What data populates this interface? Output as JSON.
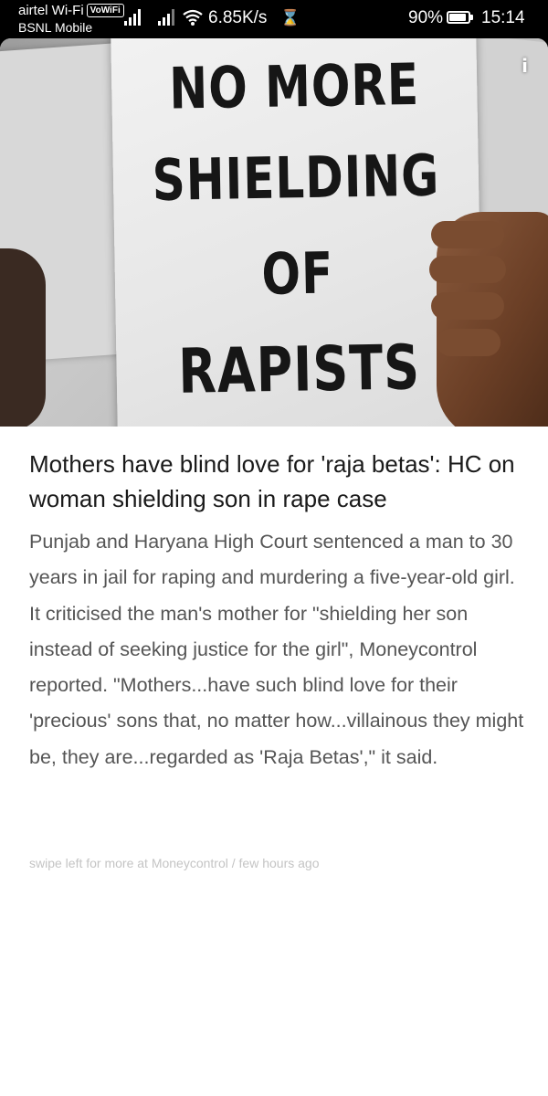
{
  "status_bar": {
    "carrier_primary": "airtel Wi-Fi",
    "volte_badge": "VoWiFi",
    "carrier_secondary": "BSNL Mobile",
    "network_speed": "6.85K/s",
    "battery_percent": "90%",
    "battery_level": 0.9,
    "time": "15:14",
    "icons": [
      "signal-icon",
      "signal-icon",
      "wifi-icon",
      "hourglass-icon",
      "battery-icon"
    ]
  },
  "article": {
    "image_sign_lines": [
      "NO MORE",
      "SHIELDING",
      "OF",
      "RAPISTS"
    ],
    "info_icon": "i",
    "headline": "Mothers have blind love for 'raja betas': HC on woman shielding son in rape case",
    "body": "Punjab and Haryana High Court sentenced a man to 30 years in jail for raping and murdering a five-year-old girl. It criticised the man's mother for \"shielding her son instead of seeking justice for the girl\", Moneycontrol reported. \"Mothers...have such blind love for their 'precious' sons that, no matter how...villainous they might be, they are...regarded as 'Raja Betas',\" it said.",
    "footer": "swipe left for more at Moneycontrol / few hours ago"
  }
}
